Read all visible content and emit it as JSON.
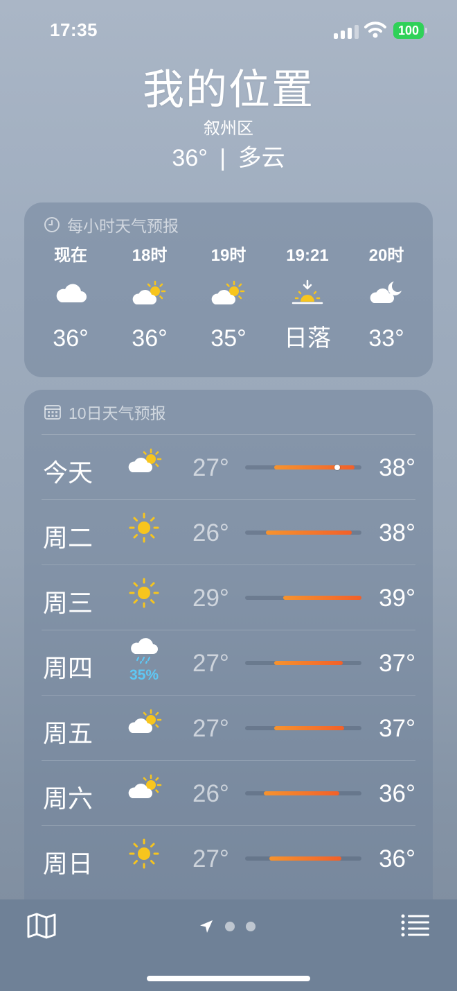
{
  "status_bar": {
    "time": "17:35",
    "battery": "100"
  },
  "location": {
    "title": "我的位置",
    "subtitle": "叙州区",
    "temp": "36°",
    "condition": "多云",
    "separator": "|"
  },
  "hourly": {
    "header": "每小时天气预报",
    "items": [
      {
        "label": "现在",
        "icon": "cloud-icon",
        "temp": "36°"
      },
      {
        "label": "18时",
        "icon": "partly-sunny-icon",
        "temp": "36°"
      },
      {
        "label": "19时",
        "icon": "partly-sunny-icon",
        "temp": "35°"
      },
      {
        "label": "19:21",
        "icon": "sunset-icon",
        "temp": "日落"
      },
      {
        "label": "20时",
        "icon": "partly-cloudy-night-icon",
        "temp": "33°"
      }
    ]
  },
  "daily": {
    "header": "10日天气预报",
    "days": [
      {
        "day": "今天",
        "icon": "partly-sunny-icon",
        "low": "27°",
        "high": "38°",
        "range_start": 0.25,
        "range_end": 0.94,
        "current": 0.79
      },
      {
        "day": "周二",
        "icon": "sun-icon",
        "low": "26°",
        "high": "38°",
        "range_start": 0.18,
        "range_end": 0.92
      },
      {
        "day": "周三",
        "icon": "sun-icon",
        "low": "29°",
        "high": "39°",
        "range_start": 0.33,
        "range_end": 1.0
      },
      {
        "day": "周四",
        "icon": "rain-icon",
        "precip": "35%",
        "low": "27°",
        "high": "37°",
        "range_start": 0.25,
        "range_end": 0.84
      },
      {
        "day": "周五",
        "icon": "partly-sunny-icon",
        "low": "27°",
        "high": "37°",
        "range_start": 0.25,
        "range_end": 0.85
      },
      {
        "day": "周六",
        "icon": "partly-sunny-icon",
        "low": "26°",
        "high": "36°",
        "range_start": 0.16,
        "range_end": 0.81
      },
      {
        "day": "周日",
        "icon": "sun-icon",
        "low": "27°",
        "high": "36°",
        "range_start": 0.21,
        "range_end": 0.83
      }
    ]
  },
  "bottom_bar": {
    "map_icon": "map-icon",
    "location_icon": "location-arrow-icon",
    "list_icon": "list-icon"
  },
  "colors": {
    "battery": "#2fd158",
    "range_start": "#f6932e",
    "range_end": "#f2602a",
    "precip": "#5ec8f5",
    "sun": "#f7c51e"
  }
}
